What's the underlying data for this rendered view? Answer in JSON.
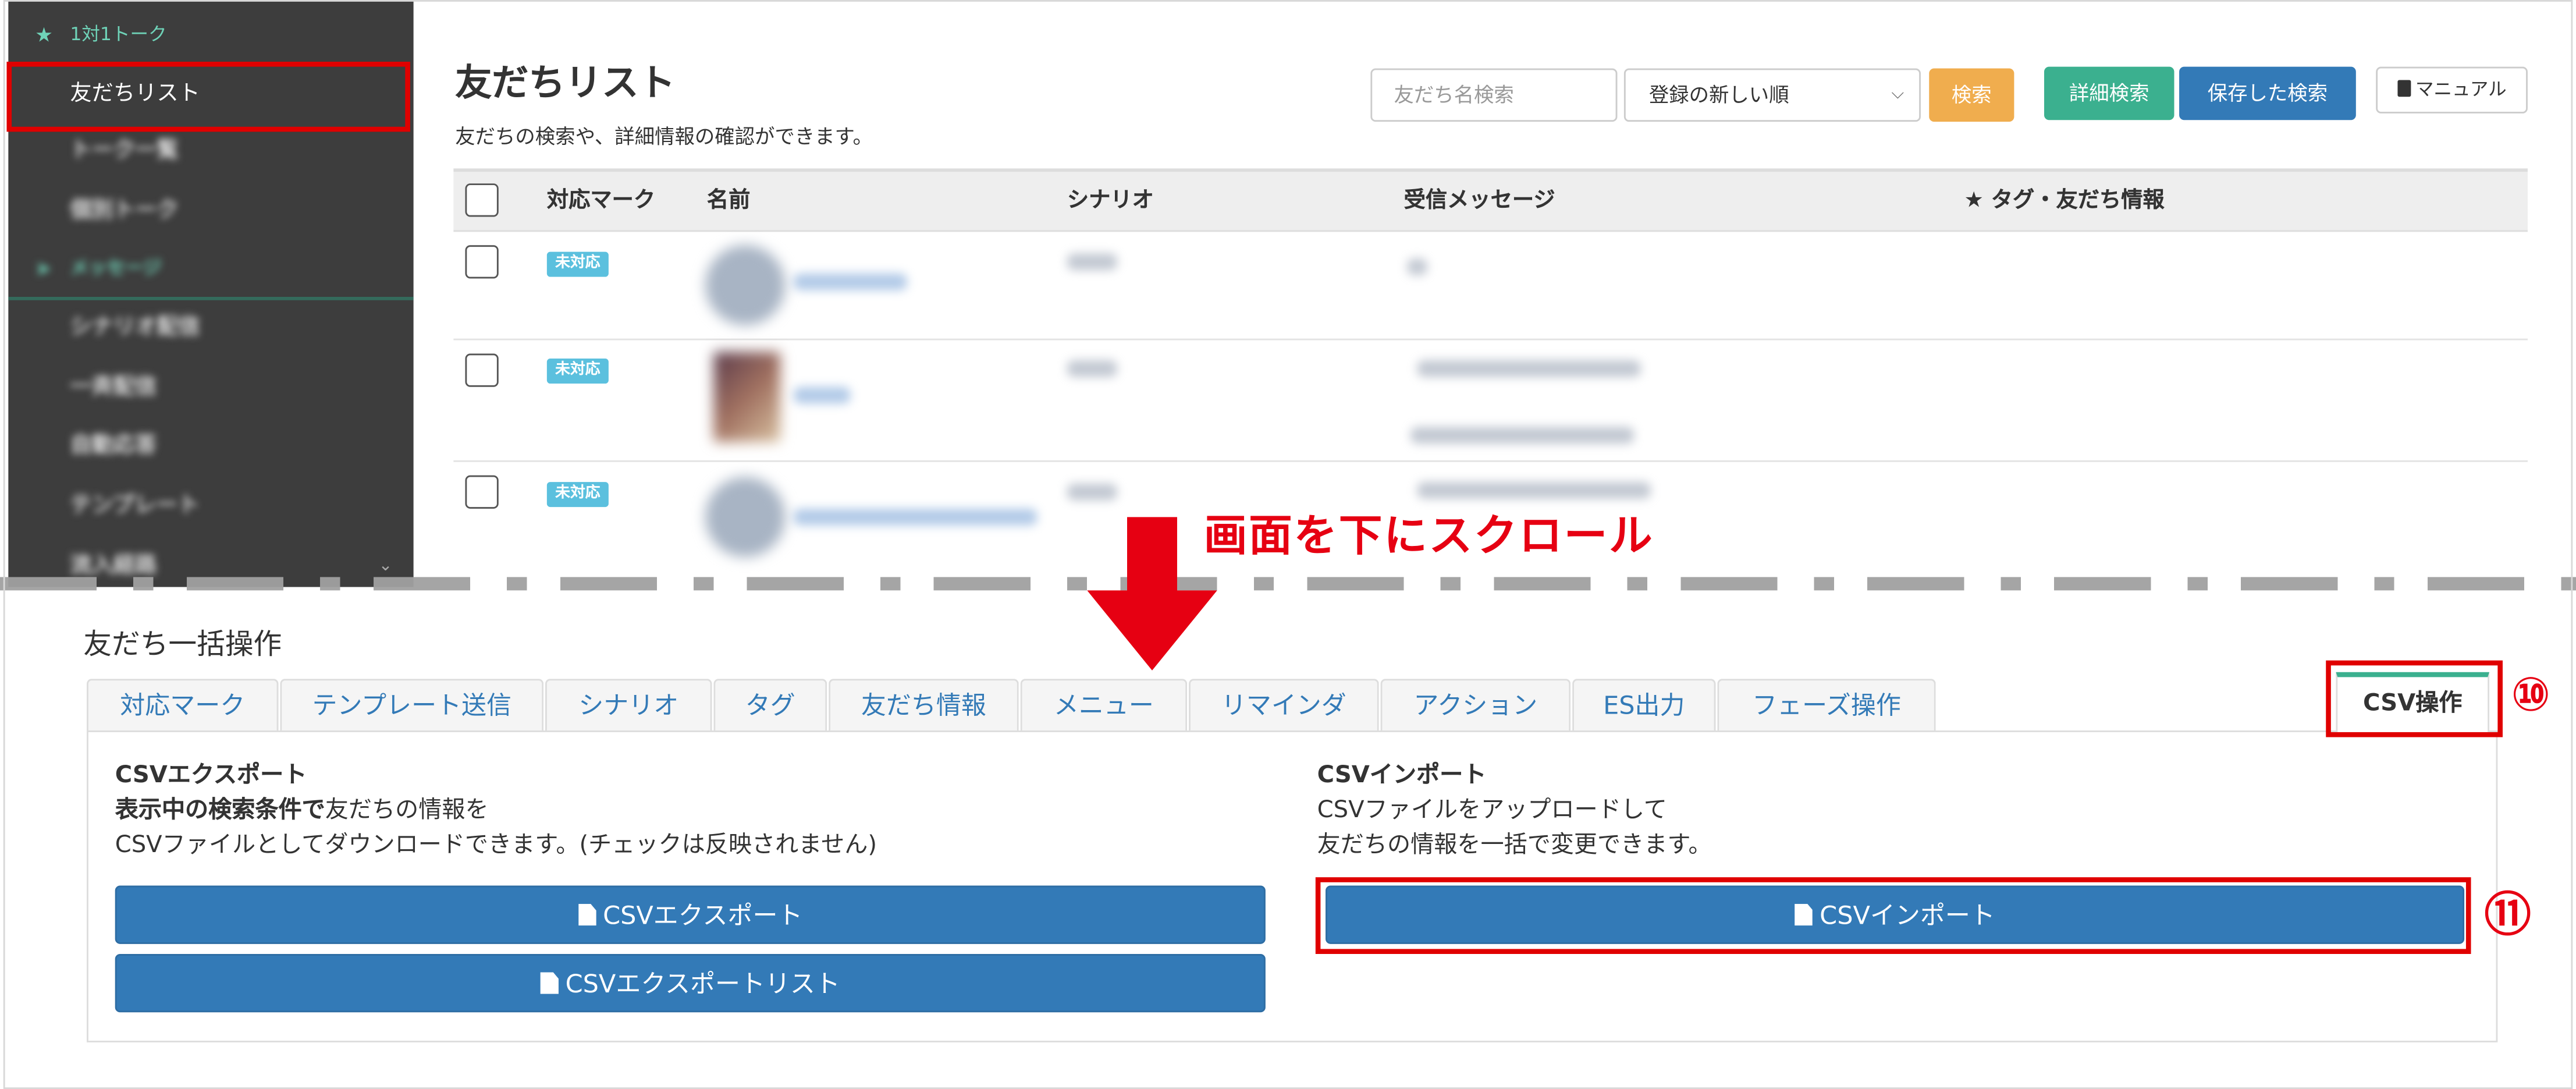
{
  "sidebar": {
    "section_one_to_one": "1対1トーク",
    "friend_list": "友だちリスト",
    "talk_list": "トーク一覧",
    "individual_talk": "個別トーク",
    "section_message": "メッセージ",
    "scenario_delivery": "シナリオ配信",
    "bulk_delivery": "一斉配信",
    "auto_reply": "自動応答",
    "template": "テンプレート",
    "more": "流入経路"
  },
  "header": {
    "title": "友だちリスト",
    "description": "友だちの検索や、詳細情報の確認ができます。",
    "search_placeholder": "友だち名検索",
    "sort_selected": "登録の新しい順",
    "search_button": "検索",
    "advanced_search_button": "詳細検索",
    "saved_search_button": "保存した検索",
    "manual_button": "マニュアル"
  },
  "table": {
    "columns": [
      "対応マーク",
      "名前",
      "シナリオ",
      "受信メッセージ",
      "★ タグ・友だち情報"
    ],
    "rows": [
      {
        "status": "未対応"
      },
      {
        "status": "未対応"
      },
      {
        "status": "未対応"
      }
    ]
  },
  "annotation": {
    "scroll_label": "画面を下にスクロール",
    "arrow_color": "#e60012",
    "callout_10": "⑩",
    "callout_11": "⑪"
  },
  "bulk": {
    "title": "友だち一括操作",
    "tabs": [
      "対応マーク",
      "テンプレート送信",
      "シナリオ",
      "タグ",
      "友だち情報",
      "メニュー",
      "リマインダ",
      "アクション",
      "ES出力",
      "フェーズ操作"
    ],
    "active_tab": "CSV操作",
    "export": {
      "heading": "CSVエクスポート",
      "line1_bold": "表示中の検索条件で",
      "line1_rest": "友だちの情報を",
      "line2": "CSVファイルとしてダウンロードできます。(チェックは反映されません)",
      "export_button": "CSVエクスポート",
      "export_list_button": "CSVエクスポートリスト"
    },
    "import": {
      "heading": "CSVインポート",
      "line1": "CSVファイルをアップロードして",
      "line2": "友だちの情報を一括で変更できます。",
      "import_button": "CSVインポート"
    }
  },
  "colors": {
    "sidebar_bg": "#3d3d3d",
    "accent_green": "#3bb08f",
    "primary_blue": "#337ab7",
    "warning_orange": "#f0ad4e",
    "highlight_red": "#e00000"
  }
}
